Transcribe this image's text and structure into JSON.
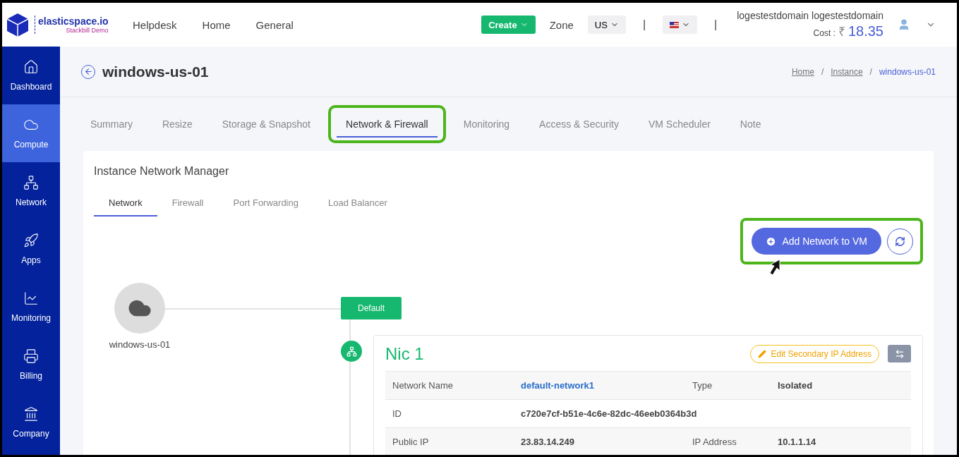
{
  "brand": {
    "name": "elasticspace.io",
    "tagline": "Stackbill Demo"
  },
  "top_nav": [
    "Helpdesk",
    "Home",
    "General"
  ],
  "header": {
    "create": "Create",
    "zone_label": "Zone",
    "zone": "US",
    "separator": "|",
    "user": "logestestdomain logestestdomain",
    "cost_label": "Cost :",
    "currency": "₹",
    "cost": "18.35"
  },
  "sidebar": {
    "items": [
      {
        "label": "Dashboard",
        "selected": false
      },
      {
        "label": "Compute",
        "selected": true
      },
      {
        "label": "Network",
        "selected": false
      },
      {
        "label": "Apps",
        "selected": false
      },
      {
        "label": "Monitoring",
        "selected": false
      },
      {
        "label": "Billing",
        "selected": false
      },
      {
        "label": "Company",
        "selected": false
      }
    ]
  },
  "page": {
    "title": "windows-us-01",
    "breadcrumb": [
      {
        "label": "Home",
        "link": true
      },
      {
        "label": "Instance",
        "link": true
      },
      {
        "label": "windows-us-01",
        "link": false
      }
    ],
    "breadcrumb_separator": "/"
  },
  "tabs": [
    {
      "label": "Summary",
      "selected": false,
      "highlighted": false
    },
    {
      "label": "Resize",
      "selected": false,
      "highlighted": false
    },
    {
      "label": "Storage & Snapshot",
      "selected": false,
      "highlighted": false
    },
    {
      "label": "Network & Firewall",
      "selected": true,
      "highlighted": true
    },
    {
      "label": "Monitoring",
      "selected": false,
      "highlighted": false
    },
    {
      "label": "Access & Security",
      "selected": false,
      "highlighted": false
    },
    {
      "label": "VM Scheduler",
      "selected": false,
      "highlighted": false
    },
    {
      "label": "Note",
      "selected": false,
      "highlighted": false
    }
  ],
  "manager": {
    "title": "Instance Network Manager",
    "subtabs": [
      {
        "label": "Network",
        "selected": true
      },
      {
        "label": "Firewall",
        "selected": false
      },
      {
        "label": "Port Forwarding",
        "selected": false
      },
      {
        "label": "Load Balancer",
        "selected": false
      }
    ],
    "add_button": "Add Network to VM",
    "actions_highlighted": true,
    "instance_name": "windows-us-01",
    "network_badge": "Default",
    "nic": {
      "title": "Nic 1",
      "edit_button": "Edit Secondary IP Address",
      "rows": [
        [
          {
            "text": "Network Name",
            "kind": "label"
          },
          {
            "text": "default-network1",
            "kind": "link"
          },
          {
            "text": "Type",
            "kind": "label"
          },
          {
            "text": "Isolated",
            "kind": "value"
          }
        ],
        [
          {
            "text": "ID",
            "kind": "label"
          },
          {
            "text": "c720e7cf-b51e-4c6e-82dc-46eeb0364b3d",
            "kind": "value"
          }
        ],
        [
          {
            "text": "Public IP",
            "kind": "label"
          },
          {
            "text": "23.83.14.249",
            "kind": "value"
          },
          {
            "text": "IP Address",
            "kind": "label"
          },
          {
            "text": "10.1.1.14",
            "kind": "value"
          }
        ]
      ]
    }
  }
}
